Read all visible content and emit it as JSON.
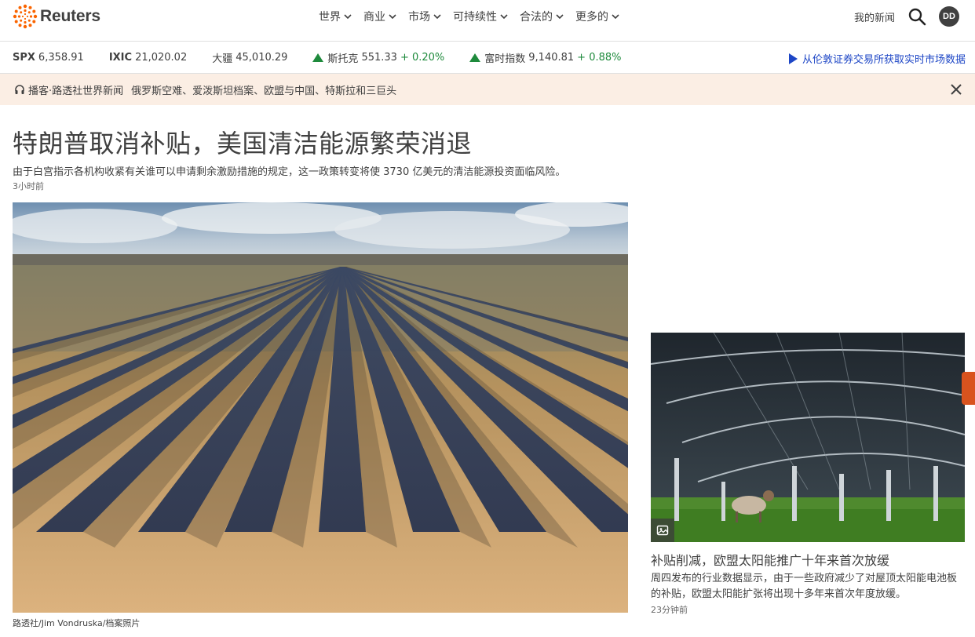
{
  "header": {
    "logo_text": "Reuters",
    "nav": [
      {
        "label": "世界"
      },
      {
        "label": "商业"
      },
      {
        "label": "市场"
      },
      {
        "label": "可持续性"
      },
      {
        "label": "合法的"
      },
      {
        "label": "更多的"
      }
    ],
    "my_news": "我的新闻",
    "avatar_initials": "DD",
    "icons": [
      "reuters-logo-icon",
      "chevron-down-icon",
      "search-icon"
    ]
  },
  "market": {
    "tickers": [
      {
        "symbol": "SPX",
        "value": "6,358.91"
      },
      {
        "symbol": "IXIC",
        "value": "21,020.02"
      },
      {
        "symbol": "大疆",
        "value": "45,010.29"
      },
      {
        "symbol": "斯托克",
        "value": "551.33",
        "change": "+ 0.20%",
        "direction": "up"
      },
      {
        "symbol": "富时指数",
        "value": "9,140.81",
        "change": "+ 0.88%",
        "direction": "up"
      }
    ],
    "data_link": "从伦敦证券交易所获取实时市场数据",
    "up_color": "#1e8a3c",
    "link_color": "#1d46c6"
  },
  "podcast": {
    "label": "播客·路透社世界新闻",
    "topics": "俄罗斯空难、爱泼斯坦档案、欧盟与中国、特斯拉和三巨头",
    "background": "#fbeee4"
  },
  "main_article": {
    "headline": "特朗普取消补贴，美国清洁能源繁荣消退",
    "summary": "由于白宫指示各机构收紧有关谁可以申请剩余激励措施的规定，这一政策转变将使 3730 亿美元的清洁能源投资面临风险。",
    "time": "3小时前",
    "image_credit": "路透社/Jim Vondruska/档案照片"
  },
  "side_article": {
    "headline": "补贴削减，欧盟太阳能推广十年来首次放缓",
    "summary": "周四发布的行业数据显示，由于一些政府减少了对屋顶太阳能电池板的补贴，欧盟太阳能扩张将出现十多年来首次年度放缓。",
    "time": "23分钟前"
  }
}
